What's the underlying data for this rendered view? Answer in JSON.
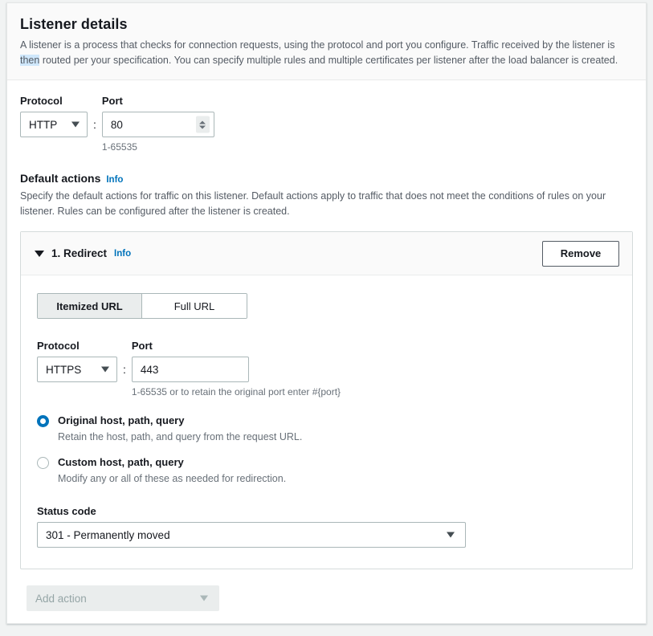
{
  "panel": {
    "title": "Listener details",
    "description_part1": "A listener is a process that checks for connection requests, using the protocol and port you configure. Traffic received by the listener is ",
    "description_highlight": "then",
    "description_part2": " routed per your specification. You can specify multiple rules and multiple certificates per listener after the load balancer is created."
  },
  "listener": {
    "protocol_label": "Protocol",
    "protocol_value": "HTTP",
    "separator": ":",
    "port_label": "Port",
    "port_value": "80",
    "port_hint": "1-65535"
  },
  "default_actions": {
    "heading": "Default actions",
    "info_label": "Info",
    "description": "Specify the default actions for traffic on this listener. Default actions apply to traffic that does not meet the conditions of rules on your listener. Rules can be configured after the listener is created."
  },
  "action_card": {
    "title": "1. Redirect",
    "info_label": "Info",
    "remove_label": "Remove",
    "url_mode_tabs": [
      {
        "label": "Itemized URL",
        "active": true
      },
      {
        "label": "Full URL",
        "active": false
      }
    ],
    "protocol_label": "Protocol",
    "protocol_value": "HTTPS",
    "separator": ":",
    "port_label": "Port",
    "port_value": "443",
    "port_hint": "1-65535 or to retain the original port enter #{port}",
    "radios": [
      {
        "label": "Original host, path, query",
        "description": "Retain the host, path, and query from the request URL.",
        "checked": true
      },
      {
        "label": "Custom host, path, query",
        "description": "Modify any or all of these as needed for redirection.",
        "checked": false
      }
    ],
    "status_code_label": "Status code",
    "status_code_value": "301 - Permanently moved"
  },
  "footer": {
    "add_action_label": "Add action"
  },
  "colors": {
    "accent_link": "#0073bb",
    "radio_selected": "#0073bb",
    "text_primary": "#16191f",
    "text_secondary": "#545b64",
    "text_muted": "#687078",
    "border": "#aab7b8",
    "card_border": "#d5dbdb",
    "header_bg": "#fafafa",
    "disabled_bg": "#eaeded",
    "selection_highlight": "#cfe7fb"
  }
}
